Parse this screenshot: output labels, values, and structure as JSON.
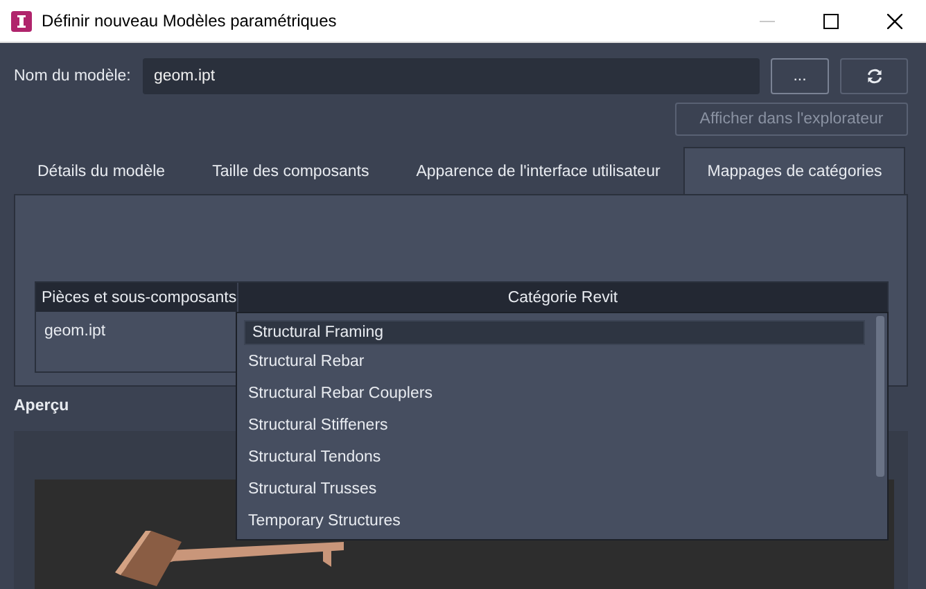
{
  "window": {
    "title": "Définir nouveau Modèles paramétriques"
  },
  "model_name": {
    "label": "Nom du modèle:",
    "value": "geom.ipt",
    "browse_button": "...",
    "show_in_explorer_button": {
      "label": "Afficher dans l'explorateur",
      "disabled": true
    }
  },
  "tabs": [
    {
      "label": "Détails du modèle",
      "selected": false
    },
    {
      "label": "Taille des composants",
      "selected": false
    },
    {
      "label": "Apparence de l'interface utilisateur",
      "selected": false
    },
    {
      "label": "Mappages de catégories",
      "selected": true
    }
  ],
  "mapping_table": {
    "columns": [
      "Pièces et sous-composants",
      "Catégorie Revit"
    ],
    "rows": [
      {
        "part": "geom.ipt"
      }
    ]
  },
  "category_dropdown": {
    "items": [
      {
        "label": "Structural Framing",
        "selected": true
      },
      {
        "label": "Structural Rebar",
        "selected": false
      },
      {
        "label": "Structural Rebar Couplers",
        "selected": false
      },
      {
        "label": "Structural Stiffeners",
        "selected": false
      },
      {
        "label": "Structural Tendons",
        "selected": false
      },
      {
        "label": "Structural Trusses",
        "selected": false
      },
      {
        "label": "Temporary Structures",
        "selected": false
      }
    ]
  },
  "preview": {
    "label": "Aperçu"
  }
}
